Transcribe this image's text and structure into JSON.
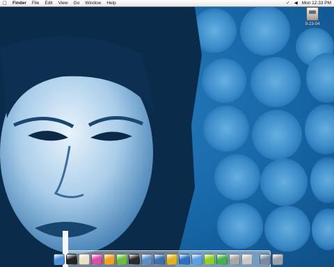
{
  "menubar": {
    "apple_menu": "apple-logo-icon",
    "app_name": "Finder",
    "menus": [
      "File",
      "Edit",
      "View",
      "Go",
      "Window",
      "Help"
    ],
    "status": {
      "script_icon": "script-menu-icon",
      "volume_icon": "volume-icon",
      "clock": "Mon 12:33 PM"
    }
  },
  "desktop": {
    "drive_label": "9-23-04",
    "drive_icon": "hard-drive-icon"
  },
  "dock": {
    "apps": [
      {
        "name": "finder-icon",
        "color": "#4a90d9"
      },
      {
        "name": "terminal-icon",
        "color": "#222222"
      },
      {
        "name": "textedit-icon",
        "color": "#e8e2c9"
      },
      {
        "name": "flower-app-icon",
        "color": "#d94fa8"
      },
      {
        "name": "pencil-app-icon",
        "color": "#f2a020"
      },
      {
        "name": "dreamweaver-icon",
        "color": "#6cbf3a"
      },
      {
        "name": "clapper-icon",
        "color": "#2a2a2a"
      },
      {
        "name": "iphoto-icon",
        "color": "#5a8fc8"
      },
      {
        "name": "preview-icon",
        "color": "#3b6fb0"
      },
      {
        "name": "x11-icon",
        "color": "#e0b020"
      },
      {
        "name": "mail-icon",
        "color": "#2f6fbf"
      },
      {
        "name": "safari-icon",
        "color": "#5aa0e0"
      },
      {
        "name": "green-app-icon",
        "color": "#8fce2e"
      },
      {
        "name": "itunes-icon",
        "color": "#47b04a"
      },
      {
        "name": "system-preferences-icon",
        "color": "#a8a8a8"
      },
      {
        "name": "apple-app-icon",
        "color": "#c8c8c8"
      }
    ],
    "docs": [
      {
        "name": "downloads-icon",
        "color": "#7a8aa0"
      },
      {
        "name": "trash-icon",
        "color": "#9aa0a8"
      }
    ]
  }
}
